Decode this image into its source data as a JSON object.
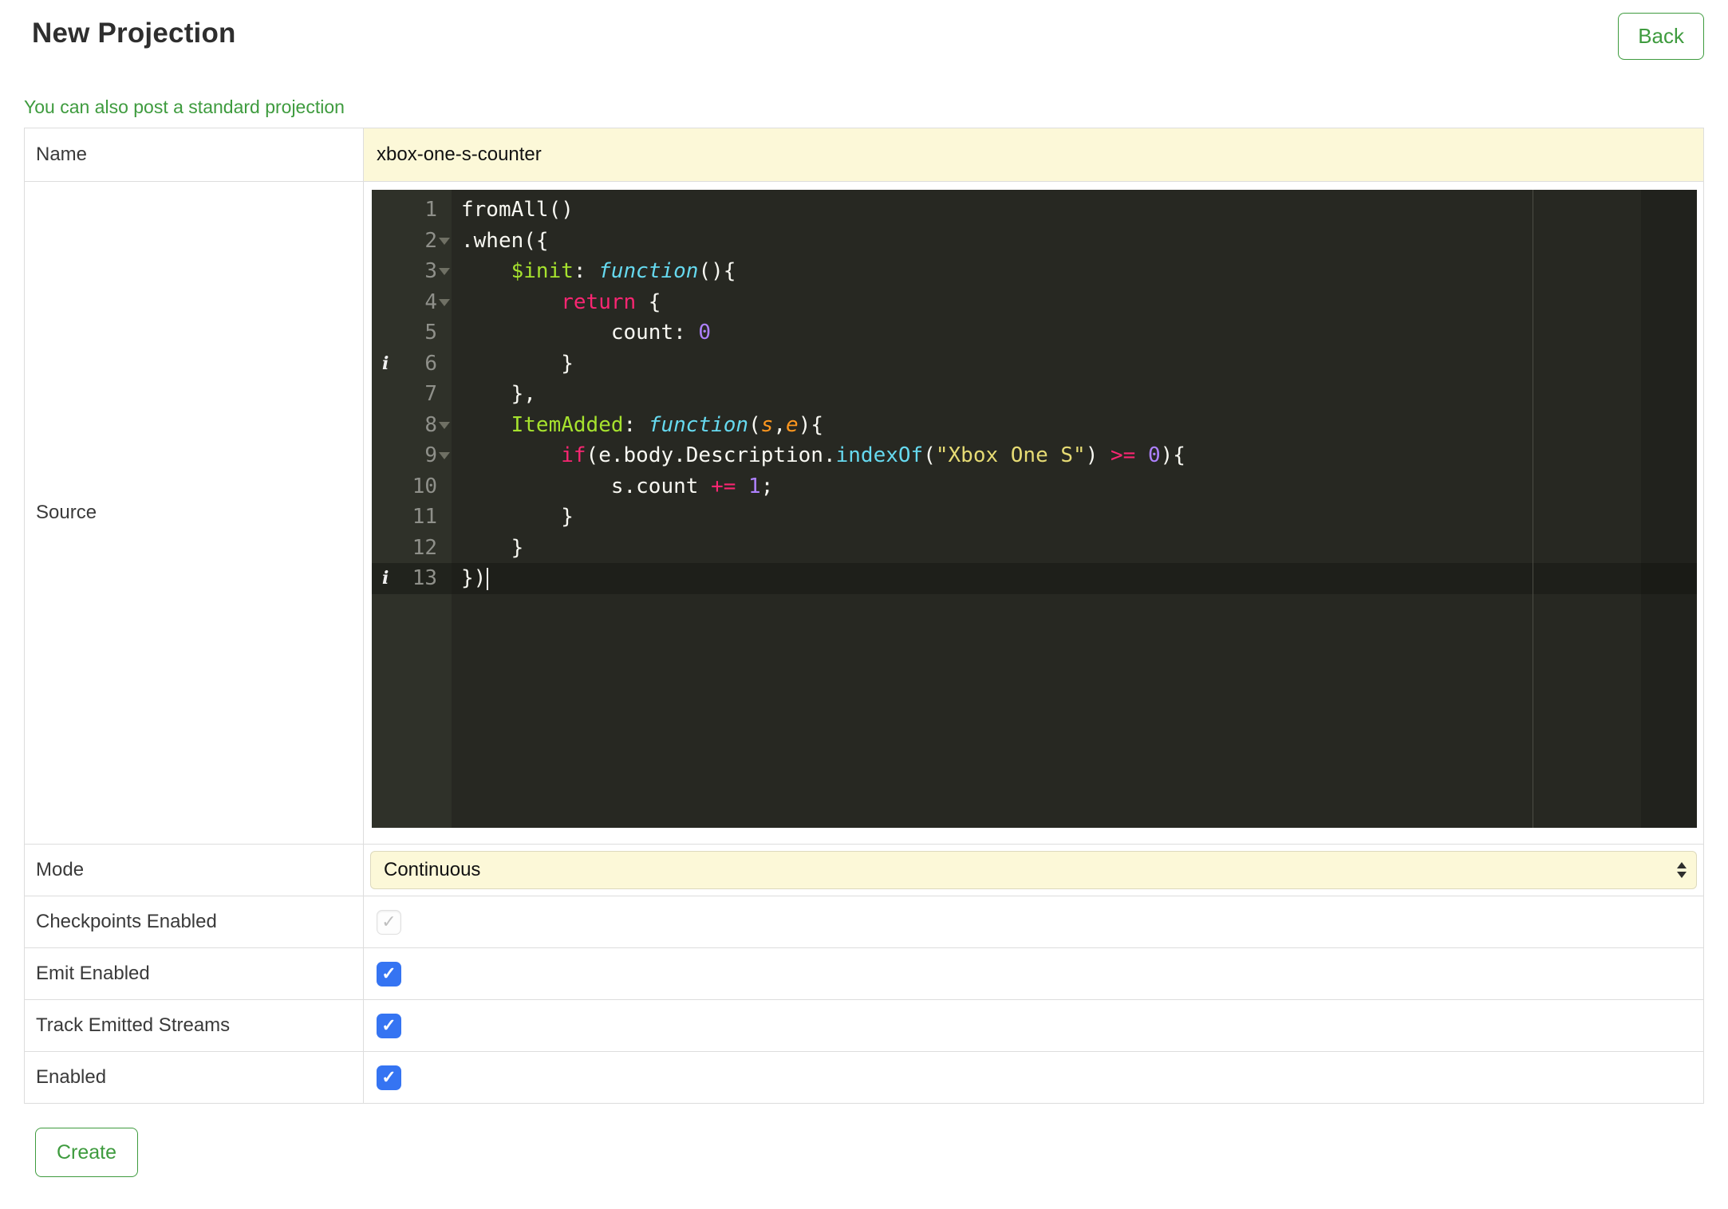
{
  "header": {
    "title": "New Projection",
    "back_label": "Back",
    "standard_projection_link": "You can also post a standard projection"
  },
  "form": {
    "name": {
      "label": "Name",
      "value": "xbox-one-s-counter"
    },
    "source": {
      "label": "Source"
    },
    "mode": {
      "label": "Mode",
      "value": "Continuous"
    },
    "checkpoints": {
      "label": "Checkpoints Enabled",
      "checked": true,
      "disabled": true
    },
    "emit": {
      "label": "Emit Enabled",
      "checked": true,
      "disabled": false
    },
    "track": {
      "label": "Track Emitted Streams",
      "checked": true,
      "disabled": false
    },
    "enabled": {
      "label": "Enabled",
      "checked": true,
      "disabled": false
    }
  },
  "footer": {
    "create_label": "Create"
  },
  "icons": {
    "check_glyph": "✓",
    "info_glyph": "i"
  },
  "colors": {
    "accent_green": "#3e9b3e",
    "field_yellow": "#fcf8d8",
    "checkbox_blue": "#3574f2",
    "editor_background": "#272822",
    "editor_gutter_background": "#2f3129",
    "token_keyword": "#f92672",
    "token_storage": "#66d9ef",
    "token_entity": "#a6e22e",
    "token_string": "#e6db74",
    "token_number": "#ae81ff",
    "token_param": "#fd971f"
  },
  "editor": {
    "lines": [
      {
        "ln": 1,
        "tokens": [
          [
            "p",
            "fromAll()"
          ]
        ]
      },
      {
        "ln": 2,
        "fold": true,
        "tokens": [
          [
            "p",
            ".when({"
          ]
        ]
      },
      {
        "ln": 3,
        "fold": true,
        "tokens": [
          [
            "p",
            "    "
          ],
          [
            "e",
            "$init"
          ],
          [
            "p",
            ": "
          ],
          [
            "s",
            "function"
          ],
          [
            "p",
            "(){"
          ]
        ]
      },
      {
        "ln": 4,
        "fold": true,
        "tokens": [
          [
            "p",
            "        "
          ],
          [
            "k",
            "return"
          ],
          [
            "p",
            " {"
          ]
        ]
      },
      {
        "ln": 5,
        "tokens": [
          [
            "p",
            "            count: "
          ],
          [
            "num",
            "0"
          ]
        ]
      },
      {
        "ln": 6,
        "info": true,
        "tokens": [
          [
            "p",
            "        }"
          ]
        ]
      },
      {
        "ln": 7,
        "tokens": [
          [
            "p",
            "    },"
          ]
        ]
      },
      {
        "ln": 8,
        "fold": true,
        "tokens": [
          [
            "p",
            "    "
          ],
          [
            "e",
            "ItemAdded"
          ],
          [
            "p",
            ": "
          ],
          [
            "s",
            "function"
          ],
          [
            "p",
            "("
          ],
          [
            "a",
            "s"
          ],
          [
            "p",
            ","
          ],
          [
            "a",
            "e"
          ],
          [
            "p",
            "){"
          ]
        ]
      },
      {
        "ln": 9,
        "fold": true,
        "tokens": [
          [
            "p",
            "        "
          ],
          [
            "k",
            "if"
          ],
          [
            "p",
            "(e.body.Description."
          ],
          [
            "f",
            "indexOf"
          ],
          [
            "p",
            "("
          ],
          [
            "str",
            "\"Xbox One S\""
          ],
          [
            "p",
            ") "
          ],
          [
            "k",
            ">="
          ],
          [
            "p",
            " "
          ],
          [
            "num",
            "0"
          ],
          [
            "p",
            "){"
          ]
        ]
      },
      {
        "ln": 10,
        "tokens": [
          [
            "p",
            "            s.count "
          ],
          [
            "k",
            "+="
          ],
          [
            "p",
            " "
          ],
          [
            "num",
            "1"
          ],
          [
            "p",
            ";"
          ]
        ]
      },
      {
        "ln": 11,
        "tokens": [
          [
            "p",
            "        }"
          ]
        ]
      },
      {
        "ln": 12,
        "tokens": [
          [
            "p",
            "    }"
          ]
        ]
      },
      {
        "ln": 13,
        "info": true,
        "active": true,
        "cursor": true,
        "tokens": [
          [
            "p",
            "})"
          ]
        ]
      }
    ]
  }
}
